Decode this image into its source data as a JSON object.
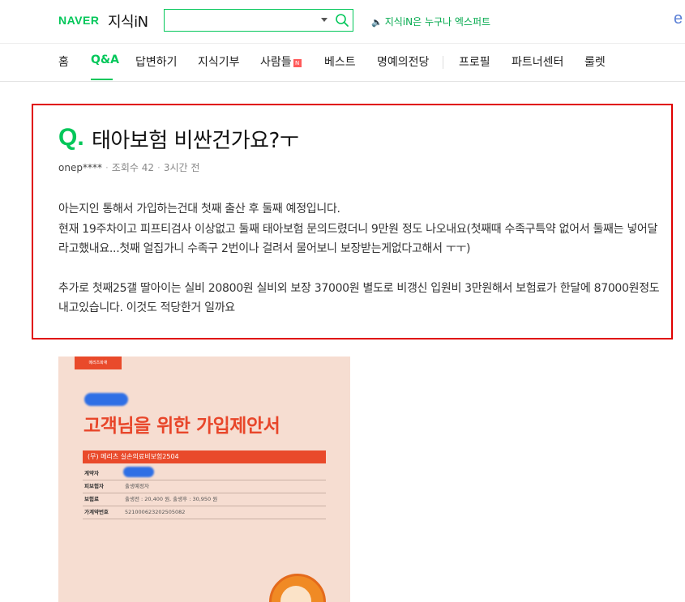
{
  "header": {
    "naver_logo": "NAVER",
    "service_name": "지식iN",
    "search": {
      "value": "",
      "placeholder": ""
    },
    "promo_text": "지식iN은 누구나 엑스퍼트",
    "edge_letter": "e"
  },
  "nav": {
    "items": [
      {
        "label": "홈",
        "active": false
      },
      {
        "label": "Q&A",
        "active": true
      },
      {
        "label": "답변하기",
        "active": false
      },
      {
        "label": "지식기부",
        "active": false
      },
      {
        "label": "사람들",
        "active": false,
        "badge": "N"
      },
      {
        "label": "베스트",
        "active": false
      },
      {
        "label": "명예의전당",
        "active": false
      },
      {
        "label": "프로필",
        "active": false
      },
      {
        "label": "파트너센터",
        "active": false
      },
      {
        "label": "룰렛",
        "active": false
      }
    ]
  },
  "question": {
    "mark": "Q.",
    "title": "태아보험 비싼건가요?ㅜ",
    "author": "onep****",
    "views_label": "조회수 42",
    "time": "3시간 전",
    "body_lines": [
      "아는지인 통해서 가입하는건대 첫째 출산 후 둘째 예정입니다.",
      "현재 19주차이고 피프티검사 이상없고 둘째 태아보험 문의드렸더니 9만원 정도 나오내요(첫째때 수족구특약 없어서 둘째는 넣어달라고했내요...첫째 얼집가니 수족구 2번이나 걸려서 물어보니 보장받는게없다고해서 ㅜㅜ)",
      "추가로 첫째25갤 딸아이는 실비 20800원 실비외 보장 37000원 별도로 비갱신 입원비 3만원해서 보험료가 한달에 87000원정도 내고있습니다. 이것도 적당한거 일까요"
    ]
  },
  "attachment": {
    "badge_text": "메리츠화재",
    "heading": "고객님을 위한 가입제안서",
    "plan_name": "(무) 메리츠 실손의료비보험2504",
    "fields": [
      {
        "label": "계약자",
        "value": ""
      },
      {
        "label": "피보험자",
        "value": "출생예정자"
      },
      {
        "label": "보험료",
        "value": "출생전 : 20,400 원, 출생후 : 30,950 원"
      },
      {
        "label": "가계약번호",
        "value": "521000623202505082"
      }
    ],
    "colors": {
      "brand_red": "#e94a2b",
      "background": "#f6ddd1"
    }
  },
  "colors": {
    "accent": "#03c75a",
    "highlight_border": "#e00000"
  }
}
